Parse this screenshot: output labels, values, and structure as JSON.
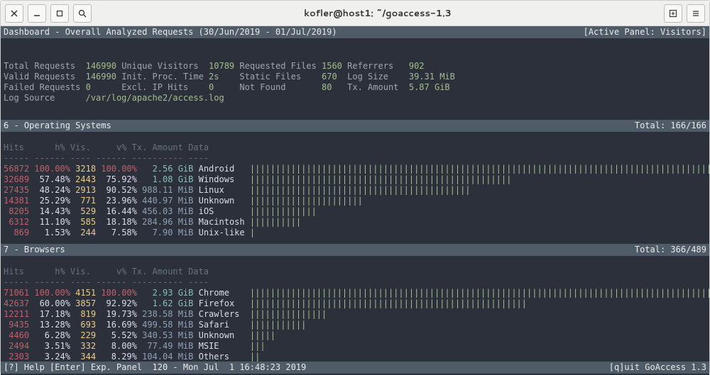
{
  "window": {
    "title": "kofler@host1: ~/goaccess-1.3"
  },
  "dashboard": {
    "title": "Dashboard - Overall Analyzed Requests (30/Jun/2019 - 01/Jul/2019)",
    "active_panel": "[Active Panel: Visitors]"
  },
  "stats": {
    "total_req_l": "Total Requests",
    "total_req_v": "146990",
    "uniq_vis_l": "Unique Visitors",
    "uniq_vis_v": "10789",
    "req_files_l": "Requested Files",
    "req_files_v": "1560",
    "ref_l": "Referrers",
    "ref_v": "902",
    "valid_req_l": "Valid Requests",
    "valid_req_v": "146990",
    "init_l": "Init. Proc. Time",
    "init_v": "2s",
    "static_l": "Static Files",
    "static_v": "670",
    "logsz_l": "Log Size",
    "logsz_v": "39.31 MiB",
    "failed_l": "Failed Requests",
    "failed_v": "0",
    "excl_l": "Excl. IP Hits",
    "excl_v": "0",
    "nf_l": "Not Found",
    "nf_v": "80",
    "tx_l": "Tx. Amount",
    "tx_v": "5.87 GiB",
    "src_l": "Log Source",
    "src_v": "/var/log/apache2/access.log"
  },
  "col_header": "Hits      h% Vis.     v% Tx. Amount Data",
  "col_sep": "----- ------ ---- ------ ---------- ----",
  "panels": {
    "os": {
      "title": " 6 - Operating Systems",
      "total": "Total: 166/166"
    },
    "br": {
      "title": " 7 - Browsers",
      "total": "Total: 366/489"
    }
  },
  "os_rows": [
    {
      "hits": "56872",
      "hp": "100.00%",
      "vis": "3218",
      "vp": "100.00%",
      "tx": "  2.56 GiB",
      "data": "Android",
      "bar": "||||||||||||||||||||||||||||||||||||||||||||||||||||||||||||||||||||||||||||||||||||||||||"
    },
    {
      "hits": "32689",
      "hp": " 57.48%",
      "vis": "2443",
      "vp": " 75.92%",
      "tx": "  1.08 GiB",
      "data": "Windows",
      "bar": "|||||||||||||||||||||||||||||||||||||||||||||||||||"
    },
    {
      "hits": "27435",
      "hp": " 48.24%",
      "vis": "2913",
      "vp": " 90.52%",
      "tx": "988.11 MiB",
      "data": "Linux",
      "bar": "|||||||||||||||||||||||||||||||||||||||||||"
    },
    {
      "hits": "14381",
      "hp": " 25.29%",
      "vis": " 771",
      "vp": " 23.96%",
      "tx": "440.97 MiB",
      "data": "Unknown",
      "bar": "||||||||||||||||||||||"
    },
    {
      "hits": " 8205",
      "hp": " 14.43%",
      "vis": " 529",
      "vp": " 16.44%",
      "tx": "456.03 MiB",
      "data": "iOS",
      "bar": "|||||||||||||"
    },
    {
      "hits": " 6312",
      "hp": " 11.10%",
      "vis": " 585",
      "vp": " 18.18%",
      "tx": "284.96 MiB",
      "data": "Macintosh",
      "bar": "||||||||||"
    },
    {
      "hits": "  869",
      "hp": "  1.53%",
      "vis": " 244",
      "vp": "  7.58%",
      "tx": "  7.90 MiB",
      "data": "Unix-like",
      "bar": "|"
    }
  ],
  "br_rows": [
    {
      "hits": "71061",
      "hp": "100.00%",
      "vis": "4151",
      "vp": "100.00%",
      "tx": "  2.93 GiB",
      "data": "Chrome",
      "bar": "||||||||||||||||||||||||||||||||||||||||||||||||||||||||||||||||||||||||||||||||||||||||||"
    },
    {
      "hits": "42637",
      "hp": " 60.00%",
      "vis": "3857",
      "vp": " 92.92%",
      "tx": "  1.62 GiB",
      "data": "Firefox",
      "bar": "||||||||||||||||||||||||||||||||||||||||||||||||||||||"
    },
    {
      "hits": "12211",
      "hp": " 17.18%",
      "vis": " 819",
      "vp": " 19.73%",
      "tx": "238.58 MiB",
      "data": "Crawlers",
      "bar": "|||||||||||||||"
    },
    {
      "hits": " 9435",
      "hp": " 13.28%",
      "vis": " 693",
      "vp": " 16.69%",
      "tx": "499.58 MiB",
      "data": "Safari",
      "bar": "|||||||||||"
    },
    {
      "hits": " 4460",
      "hp": "  6.28%",
      "vis": " 229",
      "vp": "  5.52%",
      "tx": "340.53 MiB",
      "data": "Unknown",
      "bar": "|||||"
    },
    {
      "hits": " 2494",
      "hp": "  3.51%",
      "vis": " 332",
      "vp": "  8.00%",
      "tx": " 77.49 MiB",
      "data": "MSIE",
      "bar": "|||"
    },
    {
      "hits": " 2303",
      "hp": "  3.24%",
      "vis": " 344",
      "vp": "  8.29%",
      "tx": "104.04 MiB",
      "data": "Others",
      "bar": "||"
    }
  ],
  "footer": {
    "left": "[?] Help [Enter] Exp. Panel  120 - Mon Jul  1 16:48:23 2019",
    "right": "[q]uit GoAccess 1.3"
  }
}
